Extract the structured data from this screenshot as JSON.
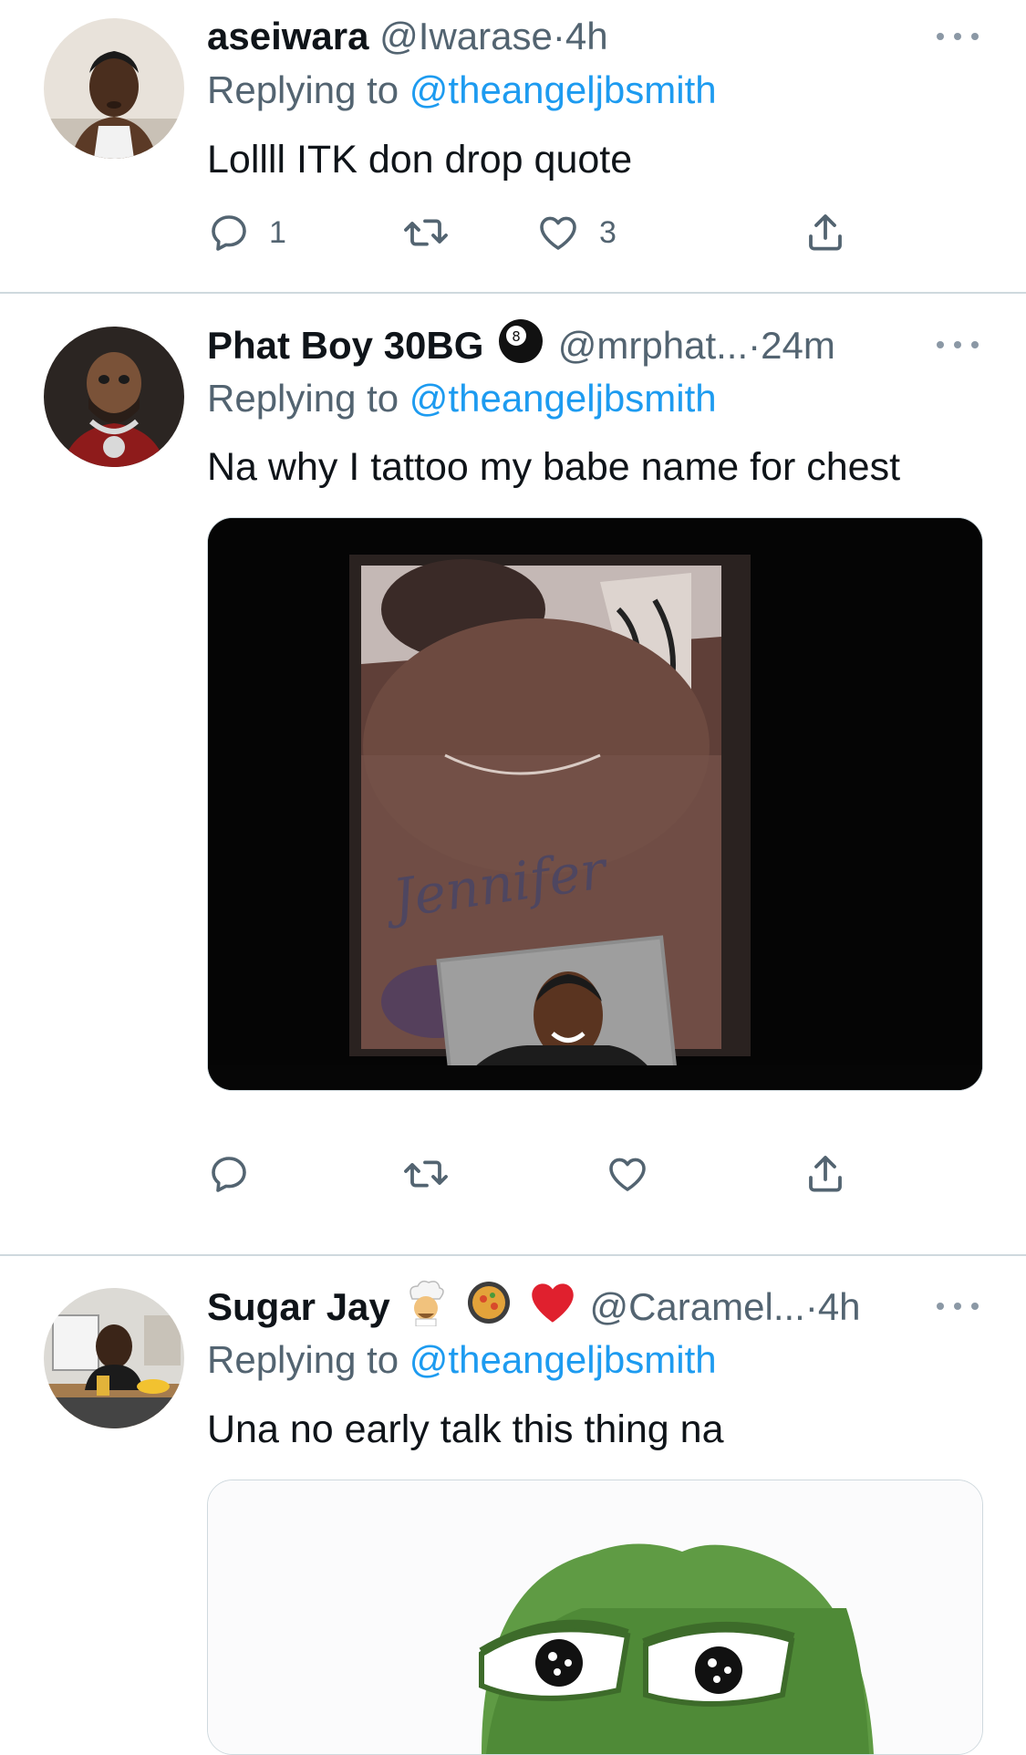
{
  "tweets": [
    {
      "display_name": "aseiwara",
      "handle": "@Iwarase",
      "sep": "·",
      "time": "4h",
      "reply_prefix": "Replying to ",
      "reply_to": "@theangeljbsmith",
      "text": "Lollll ITK don drop quote",
      "reply_count": "1",
      "like_count": "3"
    },
    {
      "display_name": "Phat Boy 30BG",
      "badge_emoji": "8-ball",
      "handle": "@mrphat...",
      "sep": "·",
      "time": "24m",
      "reply_prefix": "Replying to ",
      "reply_to": "@theangeljbsmith",
      "text": "Na why I tattoo my babe name for chest",
      "media_tattoo_text": "Jennifer"
    },
    {
      "display_name": "Sugar Jay",
      "badge_emojis": [
        "chef",
        "paella-pan",
        "red-heart"
      ],
      "handle": "@Caramel...",
      "sep": "·",
      "time": "4h",
      "reply_prefix": "Replying to ",
      "reply_to": "@theangeljbsmith",
      "text": "Una no early talk this thing na"
    }
  ],
  "icons": [
    "reply-icon",
    "retweet-icon",
    "like-icon",
    "share-icon",
    "more-icon"
  ],
  "colors": {
    "link": "#1d9bf0",
    "secondary": "#536471",
    "divider": "#cfd9de"
  }
}
